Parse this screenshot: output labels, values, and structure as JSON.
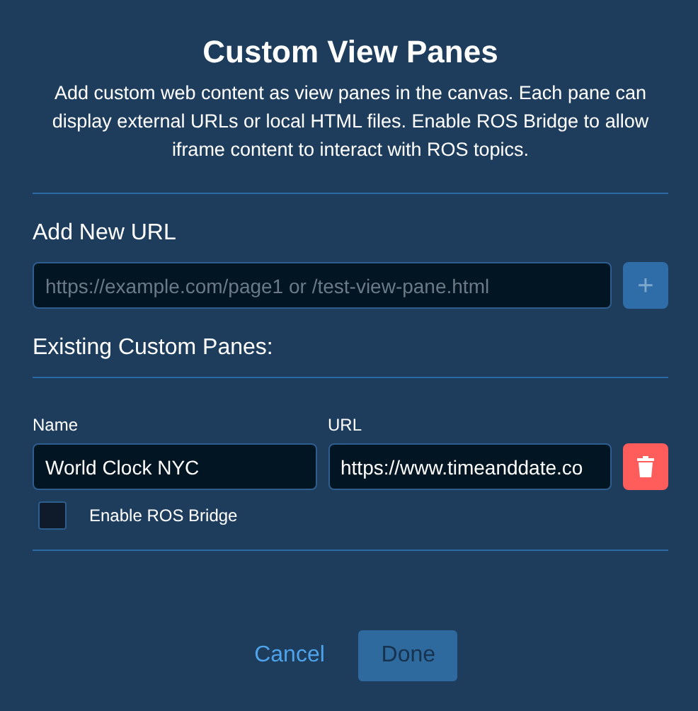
{
  "dialog": {
    "title": "Custom View Panes",
    "description": "Add custom web content as view panes in the canvas. Each pane can display external URLs or local HTML files. Enable ROS Bridge to allow iframe content to interact with ROS topics."
  },
  "add_section": {
    "label": "Add New URL",
    "placeholder": "https://example.com/page1 or /test-view-pane.html",
    "add_button": {
      "label": "+",
      "disabled": true
    }
  },
  "existing_section": {
    "label": "Existing Custom Panes:"
  },
  "panes": [
    {
      "name_label": "Name",
      "name": "World Clock NYC",
      "url_label": "URL",
      "url": "https://www.timeanddate.co",
      "ros_bridge_label": "Enable ROS Bridge",
      "ros_bridge": false
    }
  ],
  "buttons": [
    {
      "kind": "link",
      "label": "Cancel",
      "disabled": false
    },
    {
      "kind": "primary",
      "label": "Done",
      "disabled": true
    }
  ]
}
